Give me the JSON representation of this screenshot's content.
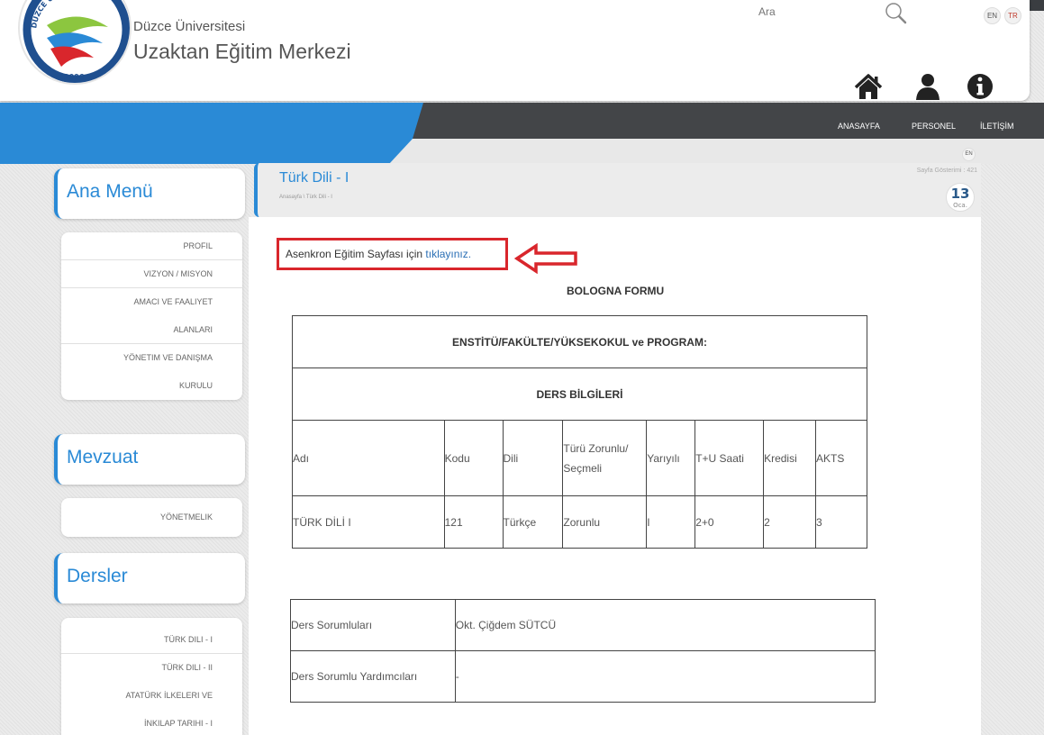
{
  "header": {
    "logo_text": "DÜZCE ÜNİVERSİTESİ",
    "logo_year": "2006",
    "university": "Düzce Üniversitesi",
    "center": "Uzaktan Eğitim Merkezi",
    "search_placeholder": "Ara",
    "lang_en": "EN",
    "lang_tr": "TR"
  },
  "nav": {
    "items": [
      "ANASAYFA",
      "PERSONEL",
      "İLETİŞİM"
    ]
  },
  "sidebar": {
    "sections": [
      {
        "title": "Ana Menü",
        "items": [
          "PROFIL",
          "VIZYON / MISYON",
          "AMACI VE FAALIYET",
          "ALANLARI",
          "YÖNETIM VE DANIŞMA",
          "KURULU"
        ]
      },
      {
        "title": "Mevzuat",
        "items": [
          "YÖNETMELIK"
        ]
      },
      {
        "title": "Dersler",
        "items": [
          "TÜRK DILI - I",
          "TÜRK DILI - II",
          "ATATÜRK İLKELERI VE",
          "İNKILAP TARIHI - I"
        ]
      }
    ]
  },
  "page": {
    "title": "Türk Dili - I",
    "breadcrumb": "Anasayfa \\ Türk Dili - I",
    "lang_en": "EN",
    "views": "Sayfa Gösterimi : 421",
    "date_day": "13",
    "date_month": "Oca."
  },
  "content": {
    "async_text": "Asenkron Eğitim Sayfası için ",
    "async_link": "tıklayınız.",
    "form_title": "BOLOGNA FORMU",
    "table1": {
      "program_row": "ENSTİTÜ/FAKÜLTE/YÜKSEKOKUL ve PROGRAM:",
      "info_row": "DERS BİLGİLERİ",
      "headers": [
        "Adı",
        "Kodu",
        "Dili",
        "Türü Zorunlu/",
        "Seçmeli",
        "Yarıyılı",
        "T+U Saati",
        "Kredisi",
        "AKTS"
      ],
      "values": [
        "TÜRK DİLİ I",
        "121",
        "Türkçe",
        "Zorunlu",
        "I",
        "2+0",
        "2",
        "3"
      ]
    },
    "table2": {
      "rows": [
        {
          "label": "Ders Sorumluları",
          "value": "Okt. Çiğdem SÜTCÜ"
        },
        {
          "label": "Ders Sorumlu Yardımcıları",
          "value": "-"
        }
      ]
    }
  }
}
